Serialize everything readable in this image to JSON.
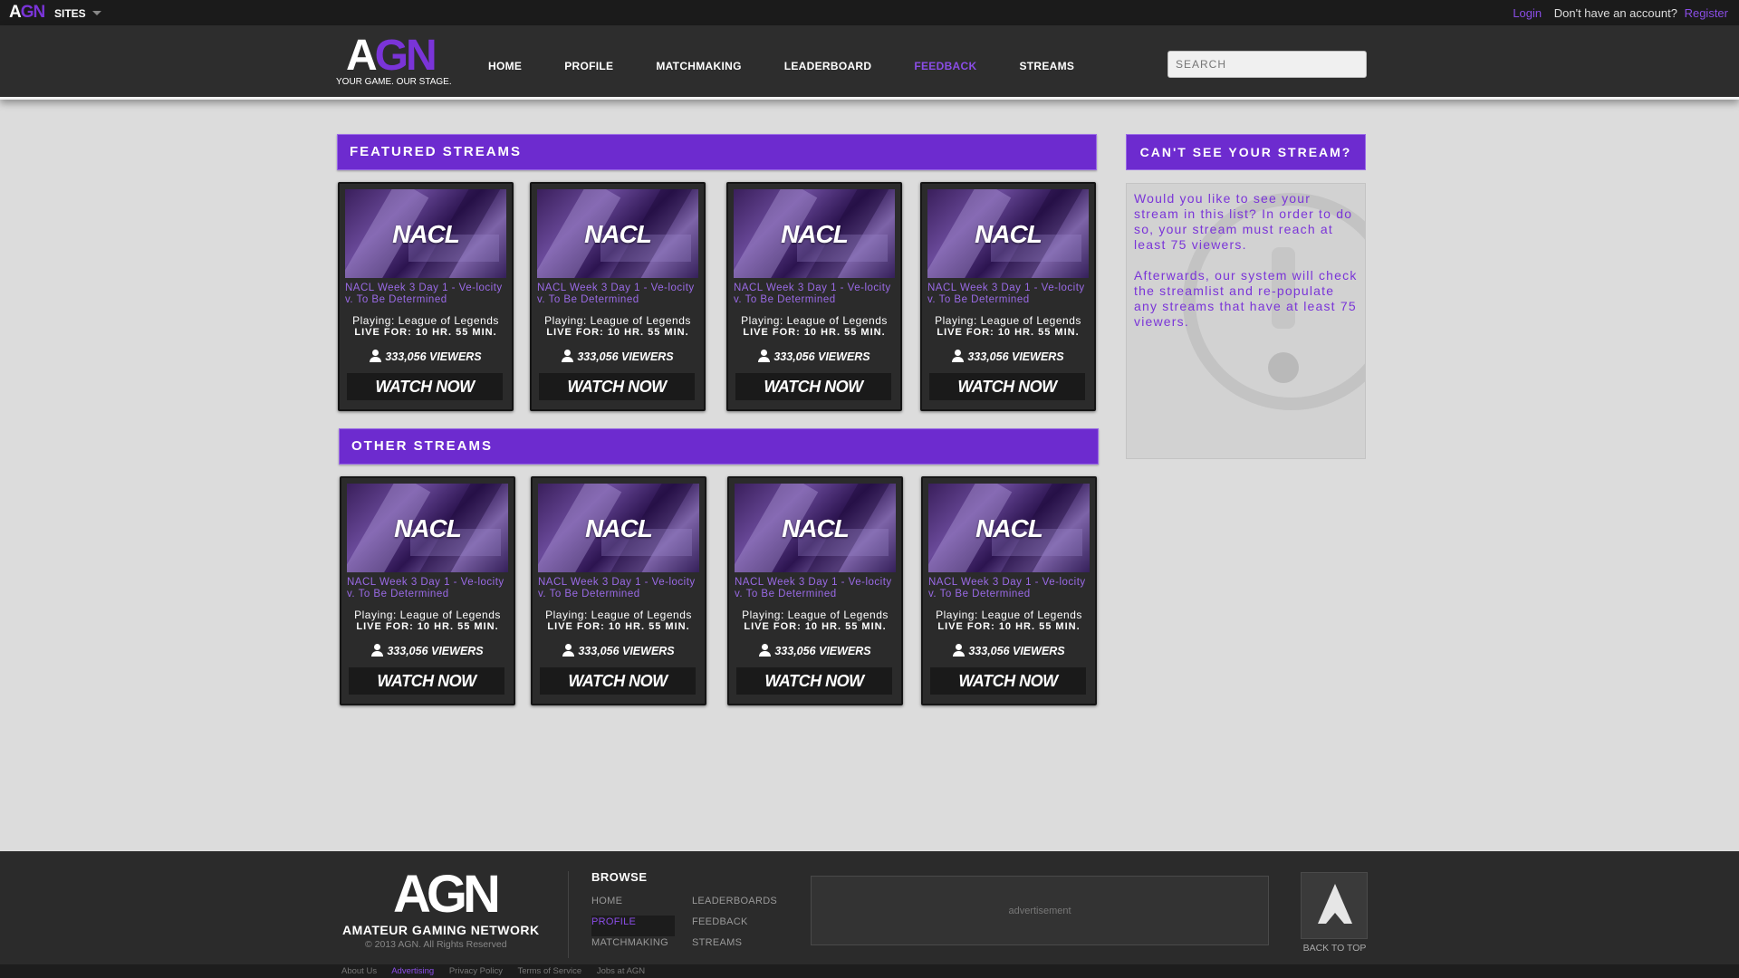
{
  "topbar": {
    "brand_a": "A",
    "brand_gn": "GN",
    "sites_label": "SITES",
    "login": "Login",
    "ask": "Don't have an account?",
    "register": "Register"
  },
  "header": {
    "logo_a": "A",
    "logo_gn": "GN",
    "tagline": "YOUR GAME. OUR STAGE.",
    "nav": [
      "HOME",
      "PROFILE",
      "MATCHMAKING",
      "LEADERBOARD",
      "FEEDBACK",
      "STREAMS"
    ],
    "active_nav": "FEEDBACK",
    "search_placeholder": "SEARCH"
  },
  "featured": {
    "heading": "FEATURED STREAMS",
    "streams": [
      {
        "thumb": "NACL",
        "title": "NACL Week 3 Day 1 - Ve-locity v. To Be Determined",
        "playing": "Playing: League of Legends",
        "live": "LIVE FOR: 10 HR. 55 MIN.",
        "viewers": "333,056 VIEWERS",
        "watch": "WATCH NOW"
      },
      {
        "thumb": "NACL",
        "title": "NACL Week 3 Day 1 - Ve-locity v. To Be Determined",
        "playing": "Playing: League of Legends",
        "live": "LIVE FOR: 10 HR. 55 MIN.",
        "viewers": "333,056 VIEWERS",
        "watch": "WATCH NOW"
      },
      {
        "thumb": "NACL",
        "title": "NACL Week 3 Day 1 - Ve-locity v. To Be Determined",
        "playing": "Playing: League of Legends",
        "live": "LIVE FOR: 10 HR. 55 MIN.",
        "viewers": "333,056 VIEWERS",
        "watch": "WATCH NOW"
      },
      {
        "thumb": "NACL",
        "title": "NACL Week 3 Day 1 - Ve-locity v. To Be Determined",
        "playing": "Playing: League of Legends",
        "live": "LIVE FOR: 10 HR. 55 MIN.",
        "viewers": "333,056 VIEWERS",
        "watch": "WATCH NOW"
      }
    ]
  },
  "other": {
    "heading": "OTHER STREAMS",
    "streams": [
      {
        "thumb": "NACL",
        "title": "NACL Week 3 Day 1 - Ve-locity v. To Be Determined",
        "playing": "Playing: League of Legends",
        "live": "LIVE FOR: 10 HR. 55 MIN.",
        "viewers": "333,056 VIEWERS",
        "watch": "WATCH NOW"
      },
      {
        "thumb": "NACL",
        "title": "NACL Week 3 Day 1 - Ve-locity v. To Be Determined",
        "playing": "Playing: League of Legends",
        "live": "LIVE FOR: 10 HR. 55 MIN.",
        "viewers": "333,056 VIEWERS",
        "watch": "WATCH NOW"
      },
      {
        "thumb": "NACL",
        "title": "NACL Week 3 Day 1 - Ve-locity v. To Be Determined",
        "playing": "Playing: League of Legends",
        "live": "LIVE FOR: 10 HR. 55 MIN.",
        "viewers": "333,056 VIEWERS",
        "watch": "WATCH NOW"
      },
      {
        "thumb": "NACL",
        "title": "NACL Week 3 Day 1 - Ve-locity v. To Be Determined",
        "playing": "Playing: League of Legends",
        "live": "LIVE FOR: 10 HR. 55 MIN.",
        "viewers": "333,056 VIEWERS",
        "watch": "WATCH NOW"
      }
    ]
  },
  "sidebar": {
    "heading": "CAN'T SEE YOUR STREAM?",
    "para1": "Would you like to see your stream in this list? In order to do so, your stream must reach at least 75 viewers.",
    "para2": "Afterwards, our system will check the streamlist and re-populate any streams that have at least 75 viewers."
  },
  "footer": {
    "logo": "AGN",
    "name": "AMATEUR GAMING NETWORK",
    "copyright": "© 2013 AGN. All Rights Reserved",
    "browse_heading": "BROWSE",
    "col1": [
      "HOME",
      "PROFILE",
      "MATCHMAKING"
    ],
    "col2": [
      "LEADERBOARDS",
      "FEEDBACK",
      "STREAMS"
    ],
    "active_link": "PROFILE",
    "ad_label": "advertisement",
    "back_to_top": "BACK TO TOP"
  },
  "bottombar": {
    "links": [
      "About Us",
      "Advertising",
      "Privacy Policy",
      "Terms of Service",
      "Jobs at AGN"
    ],
    "active_link": "Advertising"
  },
  "colors": {
    "accent": "#7a34d8",
    "header_bg": "#2d2d2d",
    "page_bg": "#dcdcdc",
    "card_bg": "#2b2b2b"
  },
  "icons": {
    "dropdown": "chevron-down-icon",
    "viewers": "person-icon",
    "back_to_top": "arrow-up-icon",
    "sidebar_bg": "question-mark-icon"
  }
}
